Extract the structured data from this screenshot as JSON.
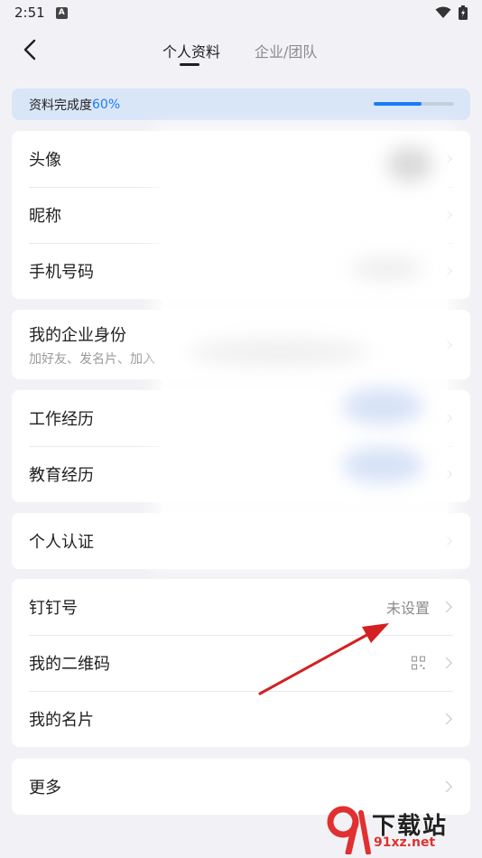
{
  "status_bar": {
    "time": "2:51",
    "notification_icon": "A"
  },
  "nav": {
    "tabs": [
      {
        "label": "个人资料",
        "active": true
      },
      {
        "label": "企业/团队",
        "active": false
      }
    ]
  },
  "profile_completion": {
    "label": "资料完成度",
    "percent_text": "60%",
    "percent": 60
  },
  "groups": {
    "basic": [
      {
        "label": "头像"
      },
      {
        "label": "昵称"
      },
      {
        "label": "手机号码"
      }
    ],
    "enterprise_identity": {
      "label": "我的企业身份",
      "sub": "加好友、发名片、加入"
    },
    "experience": [
      {
        "label": "工作经历"
      },
      {
        "label": "教育经历"
      }
    ],
    "certification": {
      "label": "个人认证"
    },
    "account": [
      {
        "label": "钉钉号",
        "value": "未设置"
      },
      {
        "label": "我的二维码"
      },
      {
        "label": "我的名片"
      }
    ],
    "more": {
      "label": "更多"
    }
  },
  "watermark": {
    "brand": "下载站",
    "url": "91xz.net"
  },
  "colors": {
    "accent": "#1a7bf5",
    "banner_bg": "#d9e6f8",
    "page_bg": "#f2f2f6",
    "arrow": "#d42020"
  }
}
